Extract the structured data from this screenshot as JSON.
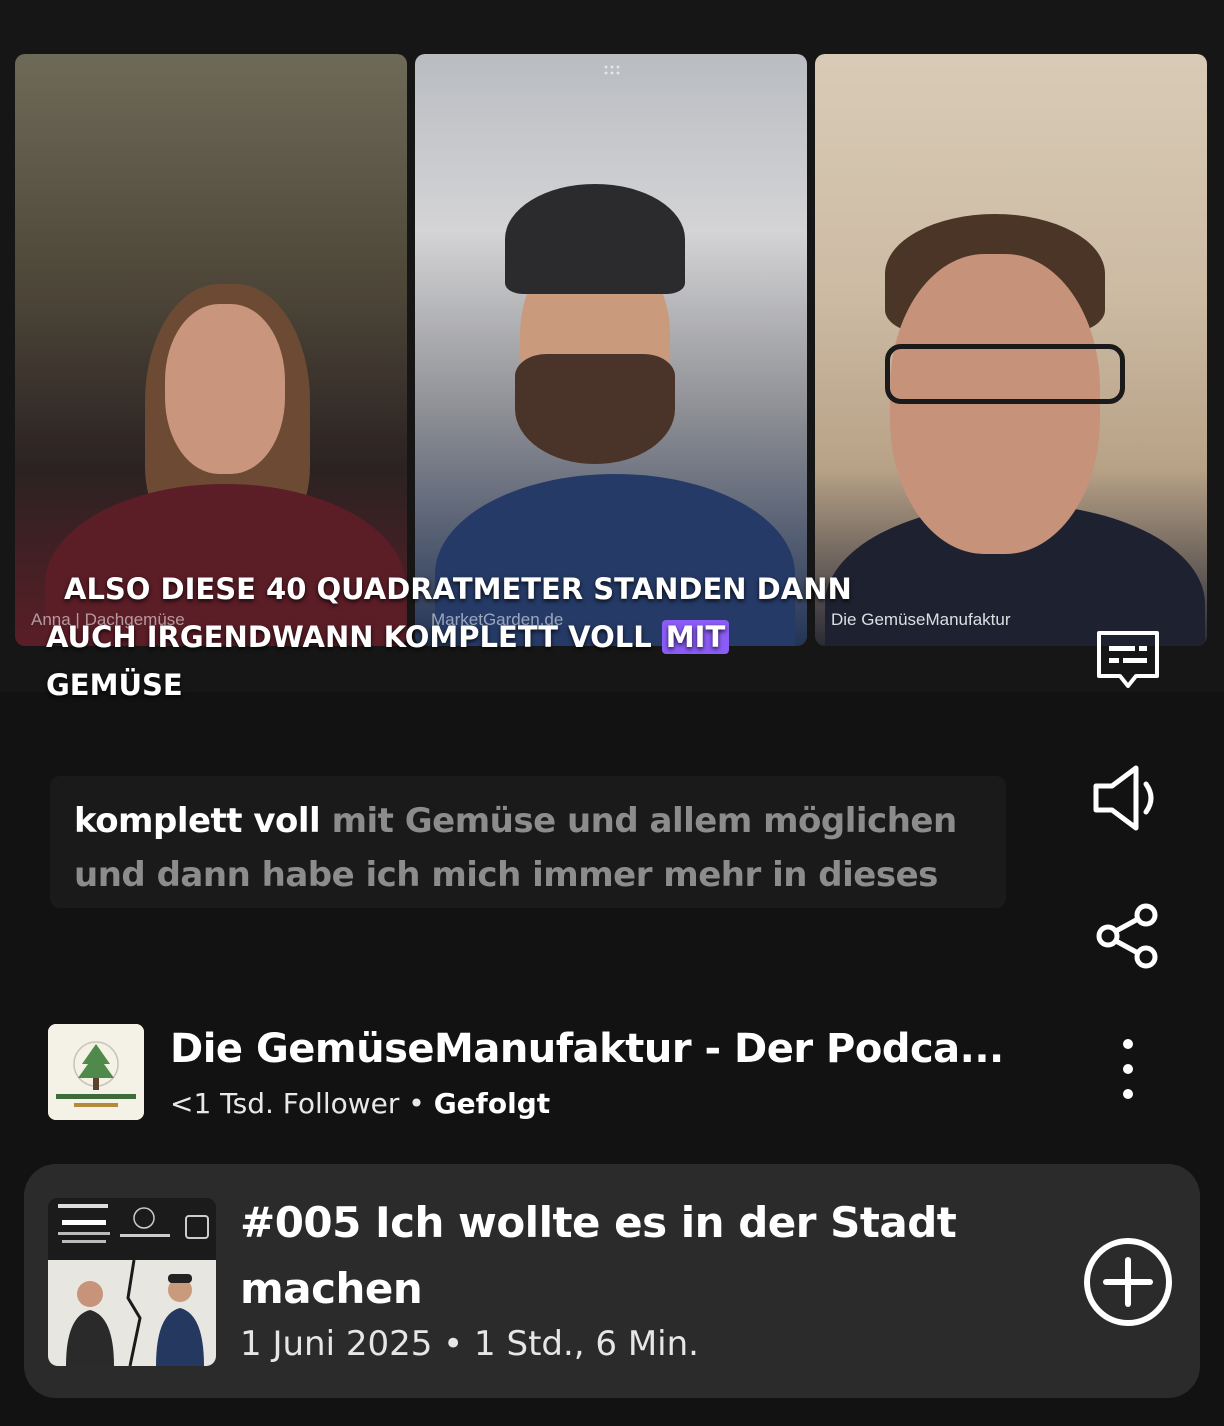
{
  "video": {
    "participants": [
      {
        "label": "Anna | Dachgemüse"
      },
      {
        "label": "MarketGarden.de"
      },
      {
        "label": "Die GemüseManufaktur"
      }
    ],
    "caption": {
      "line1": "ALSO DIESE 40 QUADRATMETER STANDEN DANN",
      "line2_before": "AUCH IRGENDWANN KOMPLETT VOLL",
      "line2_highlight": "MIT",
      "line2_after": "GEMÜSE"
    }
  },
  "transcript": {
    "spoken": "komplett voll",
    "upcoming": "mit Gemüse und allem möglichen und dann habe ich mich immer mehr in dieses"
  },
  "show": {
    "title": "Die GemüseManufaktur - Der Podca...",
    "followers": "<1 Tsd. Follower",
    "separator": "•",
    "follow_status": "Gefolgt"
  },
  "episode": {
    "title": "#005 Ich wollte es in der Stadt machen",
    "date": "1 Juni 2025",
    "separator": "•",
    "duration": "1 Std., 6 Min."
  },
  "icons": {
    "subtitles": "subtitles-icon",
    "volume": "volume-icon",
    "share": "share-icon",
    "more": "more-vertical-icon",
    "add": "add-circle-icon"
  },
  "colors": {
    "background": "#121212",
    "caption_highlight": "#8b5cf6",
    "card": "#2b2b2b",
    "transcript_upcoming": "#8c8c8c"
  }
}
